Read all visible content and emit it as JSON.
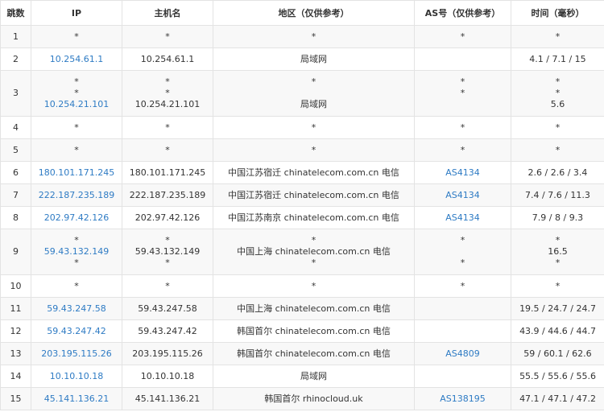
{
  "headers": [
    "跳数",
    "IP",
    "主机名",
    "地区（仅供参考）",
    "AS号（仅供参考）",
    "时间（毫秒）"
  ],
  "rows": [
    {
      "hop": "1",
      "ip": [
        "*"
      ],
      "host": [
        "*"
      ],
      "region": [
        "*"
      ],
      "as": [
        "*"
      ],
      "time": [
        "*"
      ]
    },
    {
      "hop": "2",
      "ip": [
        "10.254.61.1"
      ],
      "host": [
        "10.254.61.1"
      ],
      "region": [
        "局域网"
      ],
      "as": [
        ""
      ],
      "time": [
        "4.1 / 7.1 / 15"
      ]
    },
    {
      "hop": "3",
      "ip": [
        "*",
        "*",
        "10.254.21.101"
      ],
      "host": [
        "*",
        "*",
        "10.254.21.101"
      ],
      "region": [
        "*",
        "",
        "局域网"
      ],
      "as": [
        "*",
        "*",
        ""
      ],
      "time": [
        "*",
        "*",
        "5.6"
      ]
    },
    {
      "hop": "4",
      "ip": [
        "*"
      ],
      "host": [
        "*"
      ],
      "region": [
        "*"
      ],
      "as": [
        "*"
      ],
      "time": [
        "*"
      ]
    },
    {
      "hop": "5",
      "ip": [
        "*"
      ],
      "host": [
        "*"
      ],
      "region": [
        "*"
      ],
      "as": [
        "*"
      ],
      "time": [
        "*"
      ]
    },
    {
      "hop": "6",
      "ip": [
        "180.101.171.245"
      ],
      "host": [
        "180.101.171.245"
      ],
      "region": [
        "中国江苏宿迁 chinatelecom.com.cn 电信"
      ],
      "as": [
        "AS4134"
      ],
      "time": [
        "2.6 / 2.6 / 3.4"
      ]
    },
    {
      "hop": "7",
      "ip": [
        "222.187.235.189"
      ],
      "host": [
        "222.187.235.189"
      ],
      "region": [
        "中国江苏宿迁 chinatelecom.com.cn 电信"
      ],
      "as": [
        "AS4134"
      ],
      "time": [
        "7.4 / 7.6 / 11.3"
      ]
    },
    {
      "hop": "8",
      "ip": [
        "202.97.42.126"
      ],
      "host": [
        "202.97.42.126"
      ],
      "region": [
        "中国江苏南京 chinatelecom.com.cn 电信"
      ],
      "as": [
        "AS4134"
      ],
      "time": [
        "7.9 / 8 / 9.3"
      ]
    },
    {
      "hop": "9",
      "ip": [
        "*",
        "59.43.132.149",
        "*"
      ],
      "host": [
        "*",
        "59.43.132.149",
        "*"
      ],
      "region": [
        "*",
        "中国上海 chinatelecom.com.cn 电信",
        "*"
      ],
      "as": [
        "*",
        "",
        "*"
      ],
      "time": [
        "*",
        "16.5",
        "*"
      ]
    },
    {
      "hop": "10",
      "ip": [
        "*"
      ],
      "host": [
        "*"
      ],
      "region": [
        "*"
      ],
      "as": [
        "*"
      ],
      "time": [
        "*"
      ]
    },
    {
      "hop": "11",
      "ip": [
        "59.43.247.58"
      ],
      "host": [
        "59.43.247.58"
      ],
      "region": [
        "中国上海 chinatelecom.com.cn 电信"
      ],
      "as": [
        ""
      ],
      "time": [
        "19.5 / 24.7 / 24.7"
      ]
    },
    {
      "hop": "12",
      "ip": [
        "59.43.247.42"
      ],
      "host": [
        "59.43.247.42"
      ],
      "region": [
        "韩国首尔 chinatelecom.com.cn 电信"
      ],
      "as": [
        ""
      ],
      "time": [
        "43.9 / 44.6 / 44.7"
      ]
    },
    {
      "hop": "13",
      "ip": [
        "203.195.115.26"
      ],
      "host": [
        "203.195.115.26"
      ],
      "region": [
        "韩国首尔 chinatelecom.com.cn 电信"
      ],
      "as": [
        "AS4809"
      ],
      "time": [
        "59 / 60.1 / 62.6"
      ]
    },
    {
      "hop": "14",
      "ip": [
        "10.10.10.18"
      ],
      "host": [
        "10.10.10.18"
      ],
      "region": [
        "局域网"
      ],
      "as": [
        ""
      ],
      "time": [
        "55.5 / 55.6 / 55.6"
      ]
    },
    {
      "hop": "15",
      "ip": [
        "45.141.136.21"
      ],
      "host": [
        "45.141.136.21"
      ],
      "region": [
        "韩国首尔 rhinocloud.uk"
      ],
      "as": [
        "AS138195"
      ],
      "time": [
        "47.1 / 47.1 / 47.2"
      ]
    }
  ],
  "colors": {
    "link": "#2e7bc4",
    "text": "#333333",
    "border": "#e3e3e3",
    "stripe": "#f8f8f8"
  }
}
